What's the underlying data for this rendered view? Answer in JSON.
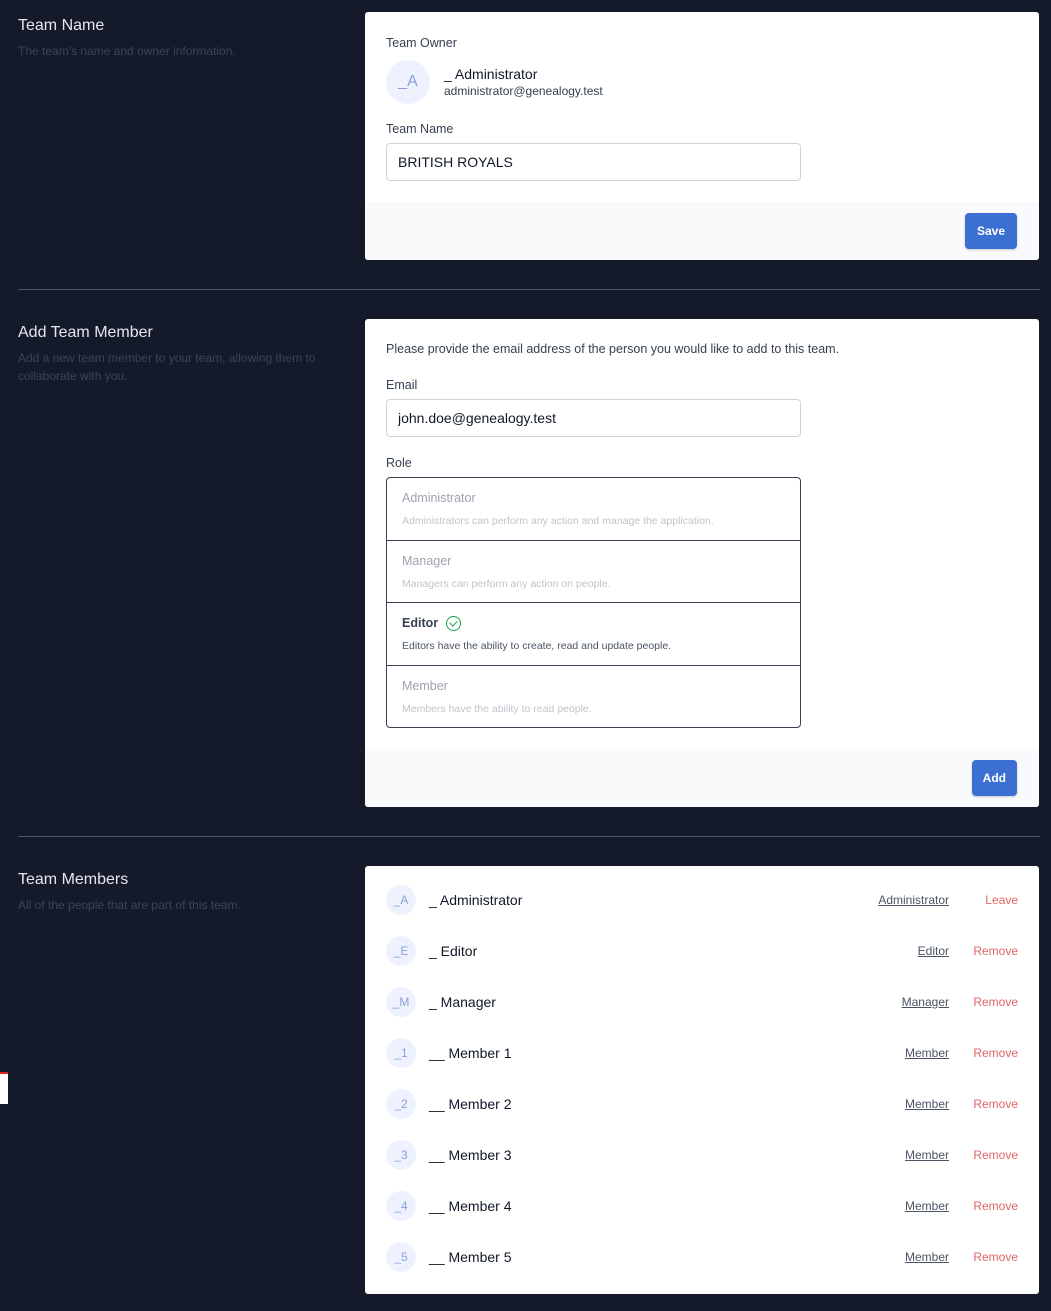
{
  "team_name_section": {
    "title": "Team Name",
    "description": "The team's name and owner information.",
    "owner_label": "Team Owner",
    "owner_avatar": "_A",
    "owner_name": "_ Administrator",
    "owner_email": "administrator@genealogy.test",
    "name_label": "Team Name",
    "name_value": "BRITISH ROYALS",
    "save_label": "Save"
  },
  "add_member_section": {
    "title": "Add Team Member",
    "description": "Add a new team member to your team, allowing them to collaborate with you.",
    "instructions": "Please provide the email address of the person you would like to add to this team.",
    "email_label": "Email",
    "email_value": "john.doe@genealogy.test",
    "role_label": "Role",
    "roles": [
      {
        "name": "Administrator",
        "description": "Administrators can perform any action and manage the application.",
        "selected": false
      },
      {
        "name": "Manager",
        "description": "Managers can perform any action on people.",
        "selected": false
      },
      {
        "name": "Editor",
        "description": "Editors have the ability to create, read and update people.",
        "selected": true
      },
      {
        "name": "Member",
        "description": "Members have the ability to read people.",
        "selected": false
      }
    ],
    "add_label": "Add"
  },
  "members_section": {
    "title": "Team Members",
    "description": "All of the people that are part of this team.",
    "members": [
      {
        "avatar": "_A",
        "name": "_ Administrator",
        "role": "Administrator",
        "action": "Leave"
      },
      {
        "avatar": "_E",
        "name": "_ Editor",
        "role": "Editor",
        "action": "Remove"
      },
      {
        "avatar": "_M",
        "name": "_ Manager",
        "role": "Manager",
        "action": "Remove"
      },
      {
        "avatar": "_1",
        "name": "__ Member 1",
        "role": "Member",
        "action": "Remove"
      },
      {
        "avatar": "_2",
        "name": "__ Member 2",
        "role": "Member",
        "action": "Remove"
      },
      {
        "avatar": "_3",
        "name": "__ Member 3",
        "role": "Member",
        "action": "Remove"
      },
      {
        "avatar": "_4",
        "name": "__ Member 4",
        "role": "Member",
        "action": "Remove"
      },
      {
        "avatar": "_5",
        "name": "__ Member 5",
        "role": "Member",
        "action": "Remove"
      }
    ]
  },
  "colors": {
    "page_bg": "#141a2a",
    "primary_button": "#3b6fd2",
    "danger_text": "#e06666",
    "check_green": "#16a34a"
  }
}
